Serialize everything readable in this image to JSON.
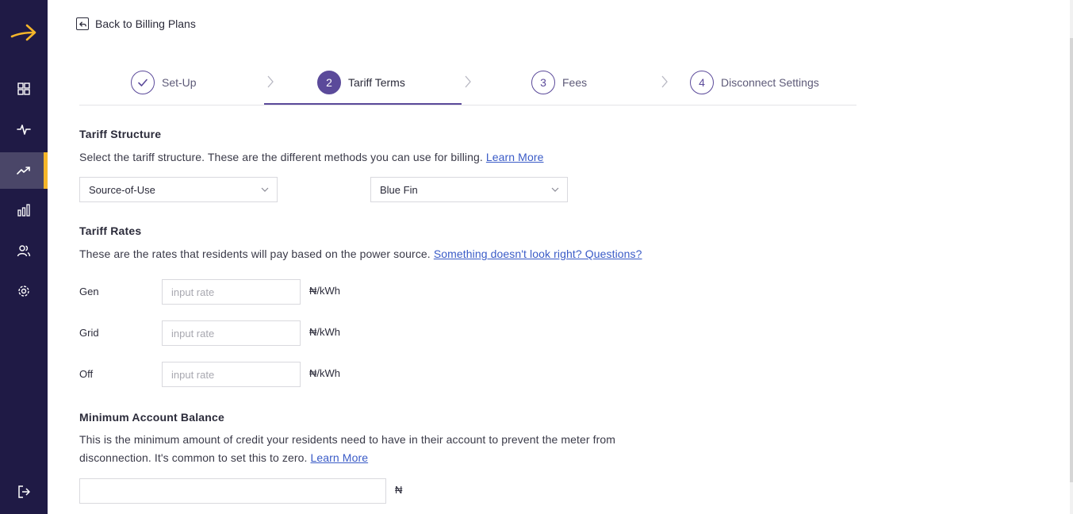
{
  "sidebar": {
    "logo": "arrow-right-logo",
    "accent_color": "#f5b62a",
    "background_color": "#1f1a45",
    "items": [
      {
        "icon": "dashboard-grid-icon"
      },
      {
        "icon": "activity-pulse-icon"
      },
      {
        "icon": "trending-up-icon",
        "active": true
      },
      {
        "icon": "bar-chart-icon"
      },
      {
        "icon": "users-icon"
      },
      {
        "icon": "settings-gear-icon"
      }
    ],
    "logout_icon": "logout-icon"
  },
  "back_link": {
    "label": "Back to Billing Plans",
    "icon": "back-arrow-icon"
  },
  "stepper": {
    "accent_color": "#5b4a9a",
    "steps": [
      {
        "number": "",
        "label": "Set-Up",
        "state": "completed"
      },
      {
        "number": "2",
        "label": "Tariff Terms",
        "state": "current"
      },
      {
        "number": "3",
        "label": "Fees",
        "state": "upcoming"
      },
      {
        "number": "4",
        "label": "Disconnect Settings",
        "state": "upcoming"
      }
    ]
  },
  "tariff_structure": {
    "title": "Tariff Structure",
    "description": "Select the tariff structure. These are the different methods you can use for billing.",
    "link": "Learn More",
    "structure_select": {
      "value": "Source-of-Use"
    },
    "provider_select": {
      "value": "Blue Fin"
    }
  },
  "tariff_rates": {
    "title": "Tariff Rates",
    "description": "These are the rates that residents will pay based on the power source.",
    "link": "Something doesn't look right? Questions?",
    "rows": [
      {
        "label": "Gen",
        "placeholder": "input rate",
        "unit": "₦/kWh"
      },
      {
        "label": "Grid",
        "placeholder": "input rate",
        "unit": "₦/kWh"
      },
      {
        "label": "Off",
        "placeholder": "input rate",
        "unit": "₦/kWh"
      }
    ]
  },
  "minimum_balance": {
    "title": "Minimum Account Balance",
    "description_line1": "This is the minimum amount of credit your residents need to have in their account to prevent the meter from",
    "description_line2": "disconnection. It's common to set this to zero.",
    "link": "Learn More",
    "value": "",
    "unit": "₦"
  }
}
